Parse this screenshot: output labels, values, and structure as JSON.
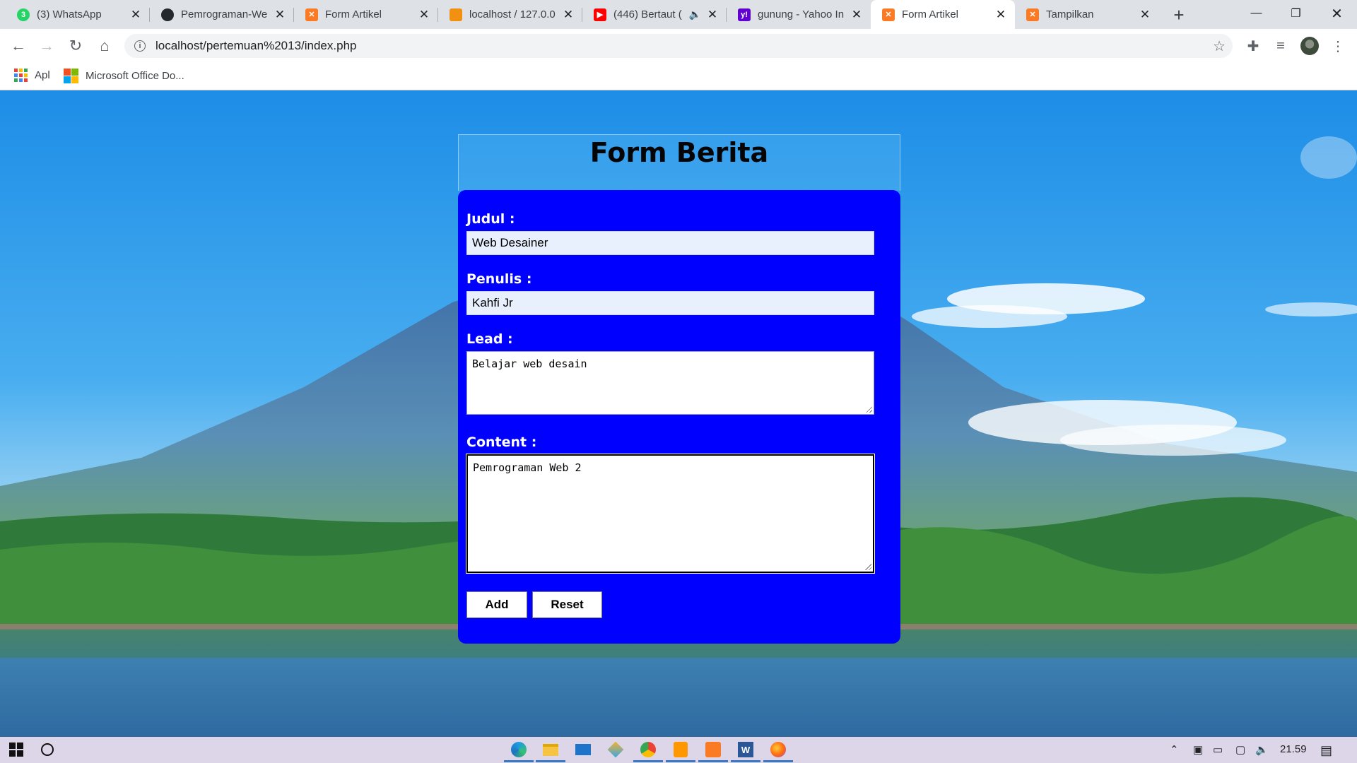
{
  "browser": {
    "tabs": [
      {
        "title": "(3) WhatsApp",
        "icon": "whatsapp-icon",
        "color": "#25d366",
        "badge": "3",
        "active": false
      },
      {
        "title": "Pemrograman-We",
        "icon": "github-icon",
        "color": "#24292e",
        "badge": "",
        "active": false
      },
      {
        "title": "Form Artikel",
        "icon": "xampp-icon",
        "color": "#fb7a24",
        "badge": "",
        "active": false
      },
      {
        "title": "localhost / 127.0.0",
        "icon": "phpmyadmin-icon",
        "color": "#f29111",
        "badge": "",
        "active": false
      },
      {
        "title": "(446) Bertaut (",
        "icon": "youtube-icon",
        "color": "#ff0000",
        "badge": "",
        "active": false
      },
      {
        "title": "gunung - Yahoo In",
        "icon": "yahoo-icon",
        "color": "#6001d2",
        "badge": "y!",
        "active": false
      },
      {
        "title": "Form Artikel",
        "icon": "xampp-icon",
        "color": "#fb7a24",
        "badge": "",
        "active": true
      },
      {
        "title": "Tampilkan",
        "icon": "xampp-icon",
        "color": "#fb7a24",
        "badge": "",
        "active": false
      }
    ],
    "address": "localhost/pertemuan%2013/index.php",
    "bookmarks": [
      {
        "label": "Apl",
        "icon": "apps-grid-icon"
      },
      {
        "label": "Microsoft Office Do...",
        "icon": "microsoft-office-icon"
      }
    ]
  },
  "form": {
    "title": "Form Berita",
    "fields": {
      "judul": {
        "label": "Judul  :",
        "value": "Web Desainer"
      },
      "penulis": {
        "label": "Penulis  :",
        "value": "Kahfi Jr"
      },
      "lead": {
        "label": "Lead  :",
        "value": "Belajar web desain"
      },
      "content": {
        "label": "Content  :",
        "value": "Pemrograman Web 2"
      }
    },
    "buttons": {
      "add": "Add",
      "reset": "Reset"
    },
    "colors": {
      "panel": "#0000ff",
      "label": "#ffffff",
      "input_fill": "#e8f0fe"
    }
  },
  "taskbar": {
    "apps": [
      "edge-icon",
      "file-explorer-icon",
      "mail-icon",
      "photos-icon",
      "chrome-icon",
      "sublime-text-icon",
      "xampp-icon",
      "word-icon",
      "firefox-icon"
    ],
    "clock": "21.59"
  }
}
